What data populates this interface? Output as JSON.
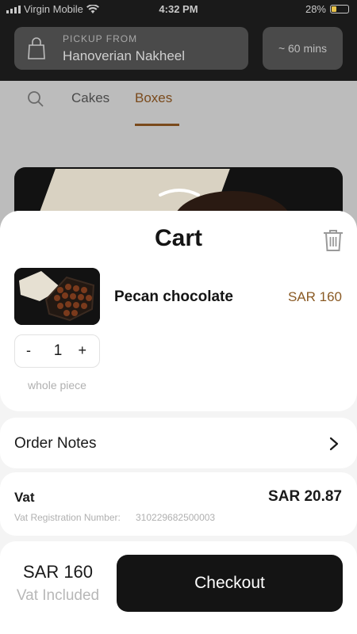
{
  "status_bar": {
    "carrier": "Virgin Mobile",
    "time": "4:32 PM",
    "battery": "28%",
    "battery_level": 0.28
  },
  "header": {
    "pickup_label": "PICKUP FROM",
    "pickup_location": "Hanoverian Nakheel",
    "pickup_icon": "shopping-bag-icon",
    "prep_time": "~ 60 mins"
  },
  "tabs": [
    {
      "label": "Cakes",
      "active": false
    },
    {
      "label": "Boxes",
      "active": true
    }
  ],
  "colors": {
    "accent": "#7a4a1c",
    "price": "#8a5a24",
    "checkout_bg": "#141414"
  },
  "cart": {
    "title": "Cart",
    "items": [
      {
        "name": "Pecan chocolate",
        "price": "SAR 160",
        "quantity": "1",
        "unit": "whole piece",
        "minus": "-",
        "plus": "+"
      }
    ]
  },
  "order_notes": {
    "label": "Order Notes"
  },
  "vat": {
    "label": "Vat",
    "amount": "SAR 20.87",
    "reg_label": "Vat Registration Number:",
    "reg_number": "310229682500003"
  },
  "footer": {
    "total": "SAR 160",
    "total_note": "Vat Included",
    "checkout_label": "Checkout"
  }
}
